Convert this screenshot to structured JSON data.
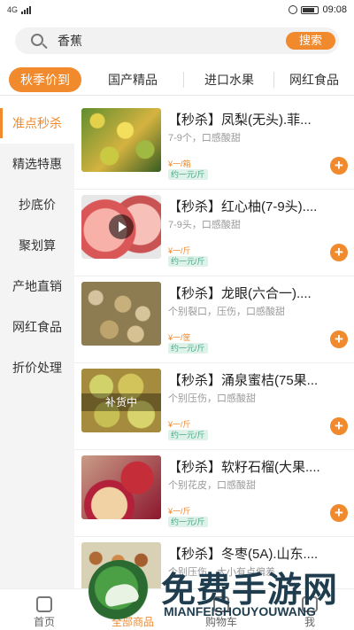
{
  "status": {
    "sim": "4G",
    "time": "09:08",
    "battery_icon": "battery-icon",
    "alarm_icon": "alarm-icon",
    "signal_icon": "signal-icon"
  },
  "search": {
    "icon": "search-icon",
    "value": "香蕉",
    "button_label": "搜索"
  },
  "tabs": [
    {
      "label": "秋季价到"
    },
    {
      "label": "国产精品"
    },
    {
      "label": "进口水果"
    },
    {
      "label": "网红食品"
    }
  ],
  "sidebar": {
    "items": [
      {
        "label": "准点秒杀"
      },
      {
        "label": "精选特惠"
      },
      {
        "label": "抄底价"
      },
      {
        "label": "聚划算"
      },
      {
        "label": "产地直销"
      },
      {
        "label": "网红食品"
      },
      {
        "label": "折价处理"
      }
    ]
  },
  "products": [
    {
      "title": "【秒杀】凤梨(无头).菲...",
      "desc": "7-9个，口感酸甜",
      "price": "¥一/箱",
      "approx": "约一元/斤"
    },
    {
      "title": "【秒杀】红心柚(7-9头)....",
      "desc": "7-9头，口感酸甜",
      "price": "¥一/斤",
      "approx": "约一元/斤"
    },
    {
      "title": "【秒杀】龙眼(六合一)....",
      "desc": "个别裂口，压伤，口感酸甜",
      "price": "¥一/筐",
      "approx": "约一元/斤"
    },
    {
      "title": "【秒杀】涌泉蜜桔(75果...",
      "desc": "个别压伤，口感酸甜",
      "price": "¥一/斤",
      "approx": "约一元/斤",
      "overlay": "补货中"
    },
    {
      "title": "【秒杀】软籽石榴(大果....",
      "desc": "个别花皮，口感酸甜",
      "price": "¥一/斤",
      "approx": "约一元/斤"
    },
    {
      "title": "【秒杀】冬枣(5A).山东....",
      "desc": "个别压伤，大小有点偏差",
      "price": "",
      "approx": ""
    }
  ],
  "bottom_nav": [
    {
      "label": "首页",
      "icon": "home-icon"
    },
    {
      "label": "全部商品",
      "icon": "all-products-icon"
    },
    {
      "label": "购物车",
      "icon": "cart-icon"
    },
    {
      "label": "我",
      "icon": "profile-icon"
    }
  ],
  "watermark": {
    "cn": "免费手游网",
    "en": "MIANFEISHOUYOUWANG"
  },
  "colors": {
    "accent": "#f08a2d",
    "approx_bg": "#dff2ea",
    "approx_text": "#4aa88a",
    "sidebar_bg": "#f4f4f4"
  }
}
